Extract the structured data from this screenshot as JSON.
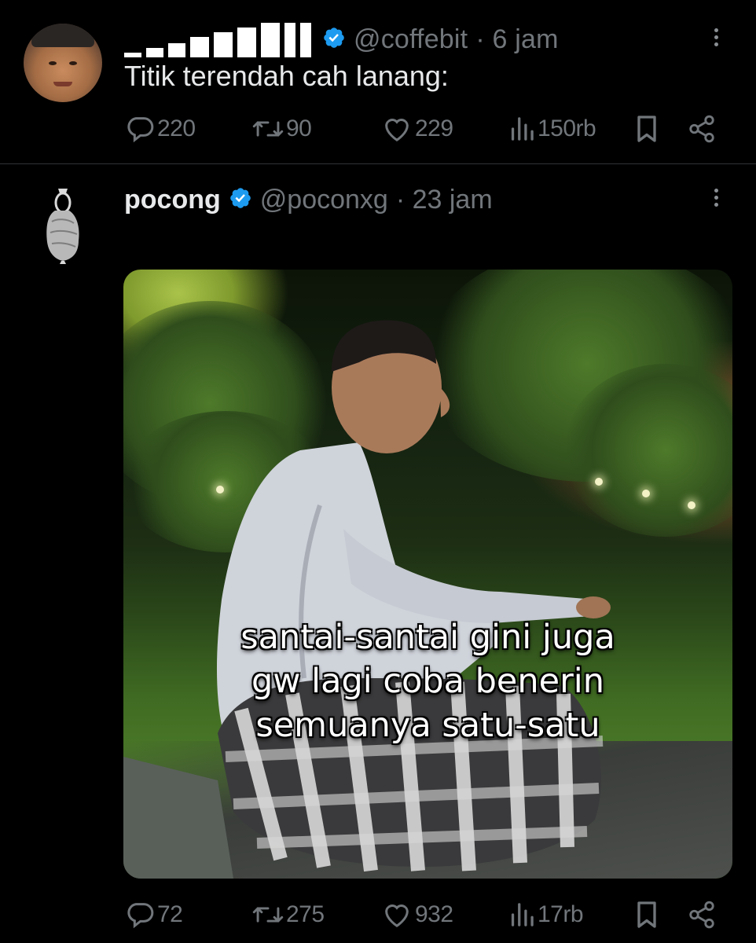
{
  "tweet1": {
    "avatar": "avatar-photo",
    "display_name_redacted": true,
    "handle": "@coffebit",
    "time": "· 6 jam",
    "text": "Titik terendah cah lanang:",
    "stats": {
      "replies": "220",
      "reposts": "90",
      "likes": "229",
      "views": "150rb"
    }
  },
  "tweet2": {
    "avatar": "pocong-avatar",
    "display_name": "pocong",
    "handle": "@poconxg",
    "time": "· 23 jam",
    "media": {
      "caption_lines": [
        "santai-santai gini juga",
        "gw lagi coba benerin",
        "semuanya satu-satu"
      ]
    },
    "stats": {
      "replies": "72",
      "reposts": "275",
      "likes": "932",
      "views": "17rb"
    }
  },
  "icons": {
    "reply": "reply-icon",
    "repost": "repost-icon",
    "like": "heart-icon",
    "views": "views-icon",
    "bookmark": "bookmark-icon",
    "share": "share-icon",
    "more": "more-options-icon",
    "verified": "verified-badge-icon"
  },
  "colors": {
    "background": "#000000",
    "text_primary": "#e7e9ea",
    "text_secondary": "#71767b",
    "verified_blue": "#1d9bf0",
    "divider": "#2f3336"
  }
}
